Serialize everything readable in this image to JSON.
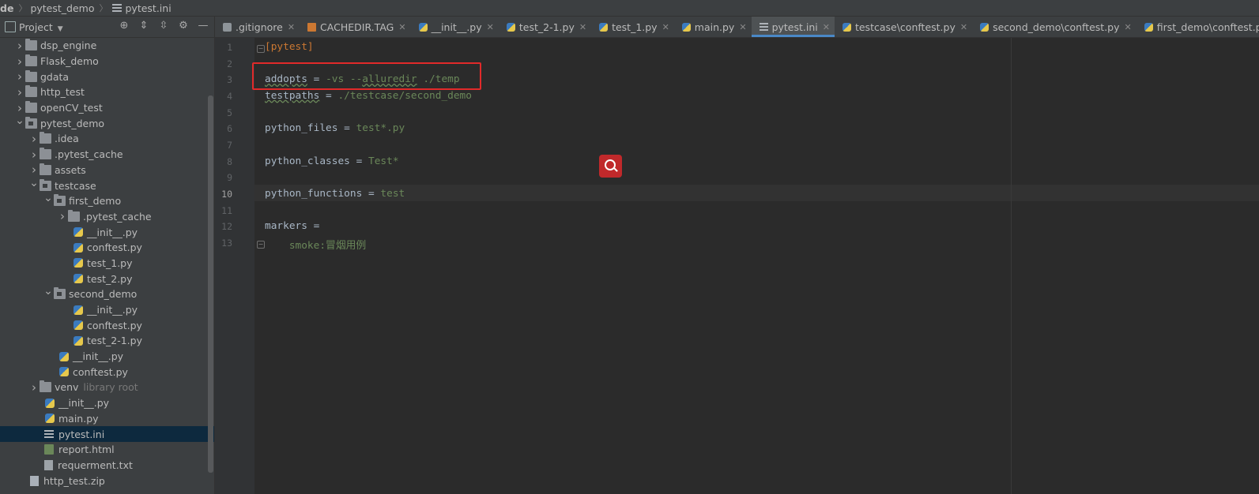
{
  "breadcrumb": {
    "lead": "de",
    "items": [
      "pytest_demo",
      "pytest.ini"
    ]
  },
  "project_panel": {
    "title": "Project",
    "tree": [
      {
        "label": "dsp_engine",
        "depth": 1,
        "type": "folder",
        "state": "collapsed"
      },
      {
        "label": "Flask_demo",
        "depth": 1,
        "type": "folder",
        "state": "collapsed"
      },
      {
        "label": "gdata",
        "depth": 1,
        "type": "folder",
        "state": "collapsed"
      },
      {
        "label": "http_test",
        "depth": 1,
        "type": "folder",
        "state": "collapsed"
      },
      {
        "label": "openCV_test",
        "depth": 1,
        "type": "folder",
        "state": "collapsed"
      },
      {
        "label": "pytest_demo",
        "depth": 1,
        "type": "package",
        "state": "expanded"
      },
      {
        "label": ".idea",
        "depth": 2,
        "type": "folder",
        "state": "collapsed"
      },
      {
        "label": ".pytest_cache",
        "depth": 2,
        "type": "folder",
        "state": "collapsed"
      },
      {
        "label": "assets",
        "depth": 2,
        "type": "folder",
        "state": "collapsed"
      },
      {
        "label": "testcase",
        "depth": 2,
        "type": "package",
        "state": "expanded"
      },
      {
        "label": "first_demo",
        "depth": 3,
        "type": "package",
        "state": "expanded"
      },
      {
        "label": ".pytest_cache",
        "depth": 4,
        "type": "folder",
        "state": "collapsed"
      },
      {
        "label": "__init__.py",
        "depth": 4,
        "type": "py"
      },
      {
        "label": "conftest.py",
        "depth": 4,
        "type": "py"
      },
      {
        "label": "test_1.py",
        "depth": 4,
        "type": "py"
      },
      {
        "label": "test_2.py",
        "depth": 4,
        "type": "py"
      },
      {
        "label": "second_demo",
        "depth": 3,
        "type": "package",
        "state": "expanded"
      },
      {
        "label": "__init__.py",
        "depth": 4,
        "type": "py"
      },
      {
        "label": "conftest.py",
        "depth": 4,
        "type": "py"
      },
      {
        "label": "test_2-1.py",
        "depth": 4,
        "type": "py"
      },
      {
        "label": "__init__.py",
        "depth": 3,
        "type": "py"
      },
      {
        "label": "conftest.py",
        "depth": 3,
        "type": "py"
      },
      {
        "label": "venv",
        "depth": 2,
        "type": "folder",
        "state": "collapsed",
        "note": "library root"
      },
      {
        "label": "__init__.py",
        "depth": 2,
        "type": "py"
      },
      {
        "label": "main.py",
        "depth": 2,
        "type": "py"
      },
      {
        "label": "pytest.ini",
        "depth": 2,
        "type": "ini",
        "selected": true
      },
      {
        "label": "report.html",
        "depth": 2,
        "type": "html"
      },
      {
        "label": "requerment.txt",
        "depth": 2,
        "type": "txt"
      },
      {
        "label": "http_test.zip",
        "depth": 1,
        "type": "zip"
      }
    ]
  },
  "tabs": [
    {
      "label": ".gitignore",
      "icon": "git"
    },
    {
      "label": "CACHEDIR.TAG",
      "icon": "tag"
    },
    {
      "label": "__init__.py",
      "icon": "py"
    },
    {
      "label": "test_2-1.py",
      "icon": "py"
    },
    {
      "label": "test_1.py",
      "icon": "py"
    },
    {
      "label": "main.py",
      "icon": "py"
    },
    {
      "label": "pytest.ini",
      "icon": "ini",
      "active": true
    },
    {
      "label": "testcase\\conftest.py",
      "icon": "py"
    },
    {
      "label": "second_demo\\conftest.py",
      "icon": "py"
    },
    {
      "label": "first_demo\\conftest.py",
      "icon": "py"
    }
  ],
  "editor": {
    "current_line": 10,
    "lines": [
      {
        "n": "1",
        "parts": [
          {
            "t": "[pytest]",
            "c": "sec"
          }
        ],
        "fold": true
      },
      {
        "n": "2",
        "parts": []
      },
      {
        "n": "3",
        "parts": [
          {
            "t": "addopts",
            "c": "k u"
          },
          {
            "t": " = ",
            "c": "k"
          },
          {
            "t": "-vs --",
            "c": "v"
          },
          {
            "t": "alluredir",
            "c": "v u"
          },
          {
            "t": " ./temp",
            "c": "v"
          }
        ]
      },
      {
        "n": "4",
        "parts": [
          {
            "t": "testpaths",
            "c": "k u"
          },
          {
            "t": " = ",
            "c": "k"
          },
          {
            "t": "./testcase/second_demo",
            "c": "v"
          }
        ]
      },
      {
        "n": "5",
        "parts": []
      },
      {
        "n": "6",
        "parts": [
          {
            "t": "python_files",
            "c": "k"
          },
          {
            "t": " = ",
            "c": "k"
          },
          {
            "t": "test*.py",
            "c": "v"
          }
        ]
      },
      {
        "n": "7",
        "parts": []
      },
      {
        "n": "8",
        "parts": [
          {
            "t": "python_classes",
            "c": "k"
          },
          {
            "t": " = ",
            "c": "k"
          },
          {
            "t": "Test*",
            "c": "v"
          }
        ]
      },
      {
        "n": "9",
        "parts": []
      },
      {
        "n": "10",
        "parts": [
          {
            "t": "python_functions",
            "c": "k"
          },
          {
            "t": " = ",
            "c": "k"
          },
          {
            "t": "test",
            "c": "v"
          }
        ]
      },
      {
        "n": "11",
        "parts": []
      },
      {
        "n": "12",
        "parts": [
          {
            "t": "markers",
            "c": "k"
          },
          {
            "t": " =",
            "c": "k"
          }
        ]
      },
      {
        "n": "13",
        "parts": [
          {
            "t": "    smoke:冒烟用例",
            "c": "v"
          }
        ],
        "fold": true
      }
    ]
  },
  "colors": {
    "highlight_box": "#e12a2a",
    "search_button": "#c0292b",
    "accent": "#4a88c7"
  }
}
